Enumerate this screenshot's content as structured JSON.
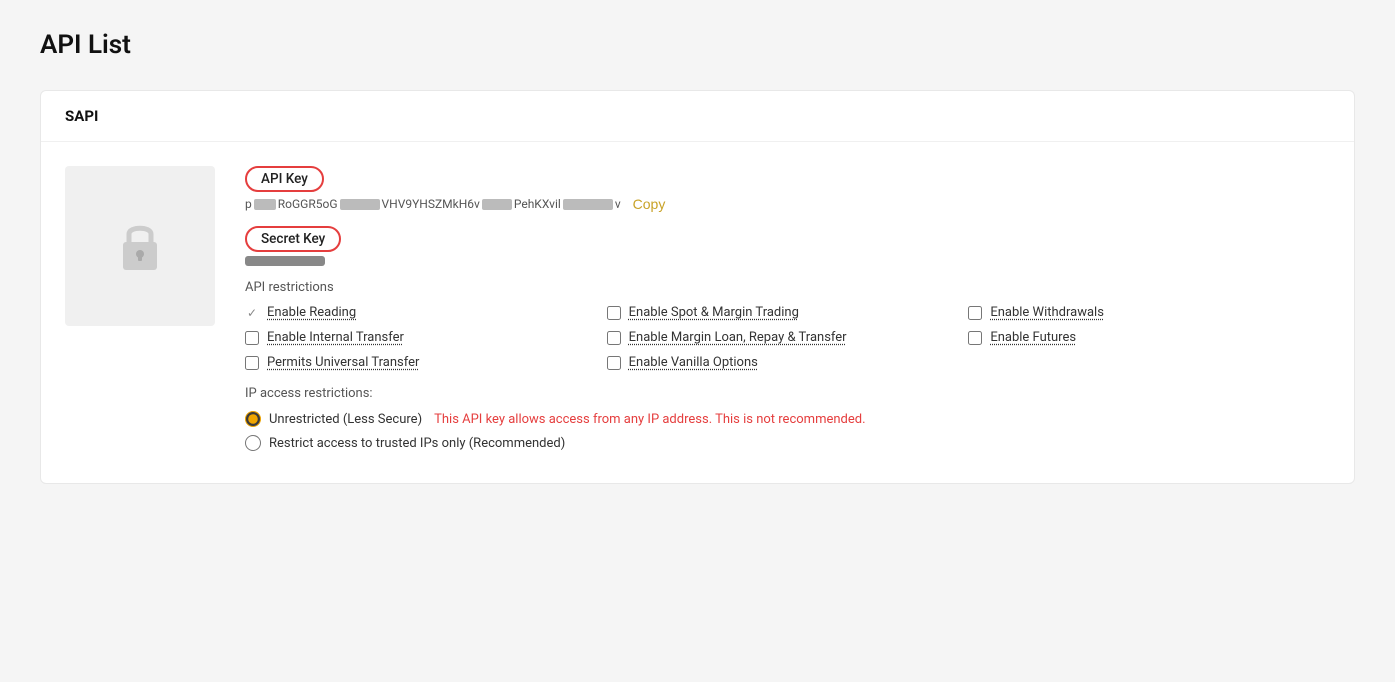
{
  "page": {
    "title": "API List"
  },
  "card": {
    "header": "SAPI"
  },
  "api_key": {
    "label": "API Key",
    "value_parts": [
      "p",
      "RoGGR5oG",
      "VHV9YHSZMkH6v",
      "PehKXvil",
      "v"
    ],
    "copy_label": "Copy"
  },
  "secret_key": {
    "label": "Secret Key"
  },
  "restrictions": {
    "title": "API restrictions",
    "items": [
      {
        "id": "enable_reading",
        "label": "Enable Reading",
        "checked": true,
        "col": 1
      },
      {
        "id": "enable_spot_margin",
        "label": "Enable Spot & Margin Trading",
        "checked": false,
        "col": 2
      },
      {
        "id": "enable_withdrawals",
        "label": "Enable Withdrawals",
        "checked": false,
        "col": 3
      },
      {
        "id": "enable_internal_transfer",
        "label": "Enable Internal Transfer",
        "checked": false,
        "col": 1
      },
      {
        "id": "enable_margin_loan",
        "label": "Enable Margin Loan, Repay & Transfer",
        "checked": false,
        "col": 2
      },
      {
        "id": "enable_futures",
        "label": "Enable Futures",
        "checked": false,
        "col": 3
      },
      {
        "id": "permits_universal_transfer",
        "label": "Permits Universal Transfer",
        "checked": false,
        "col": 1
      },
      {
        "id": "enable_vanilla_options",
        "label": "Enable Vanilla Options",
        "checked": false,
        "col": 2
      }
    ]
  },
  "ip_restrictions": {
    "title": "IP access restrictions:",
    "options": [
      {
        "id": "unrestricted",
        "label": "Unrestricted (Less Secure)",
        "warning": "This API key allows access from any IP address. This is not recommended.",
        "selected": true
      },
      {
        "id": "restrict",
        "label": "Restrict access to trusted IPs only (Recommended)",
        "warning": "",
        "selected": false
      }
    ]
  }
}
